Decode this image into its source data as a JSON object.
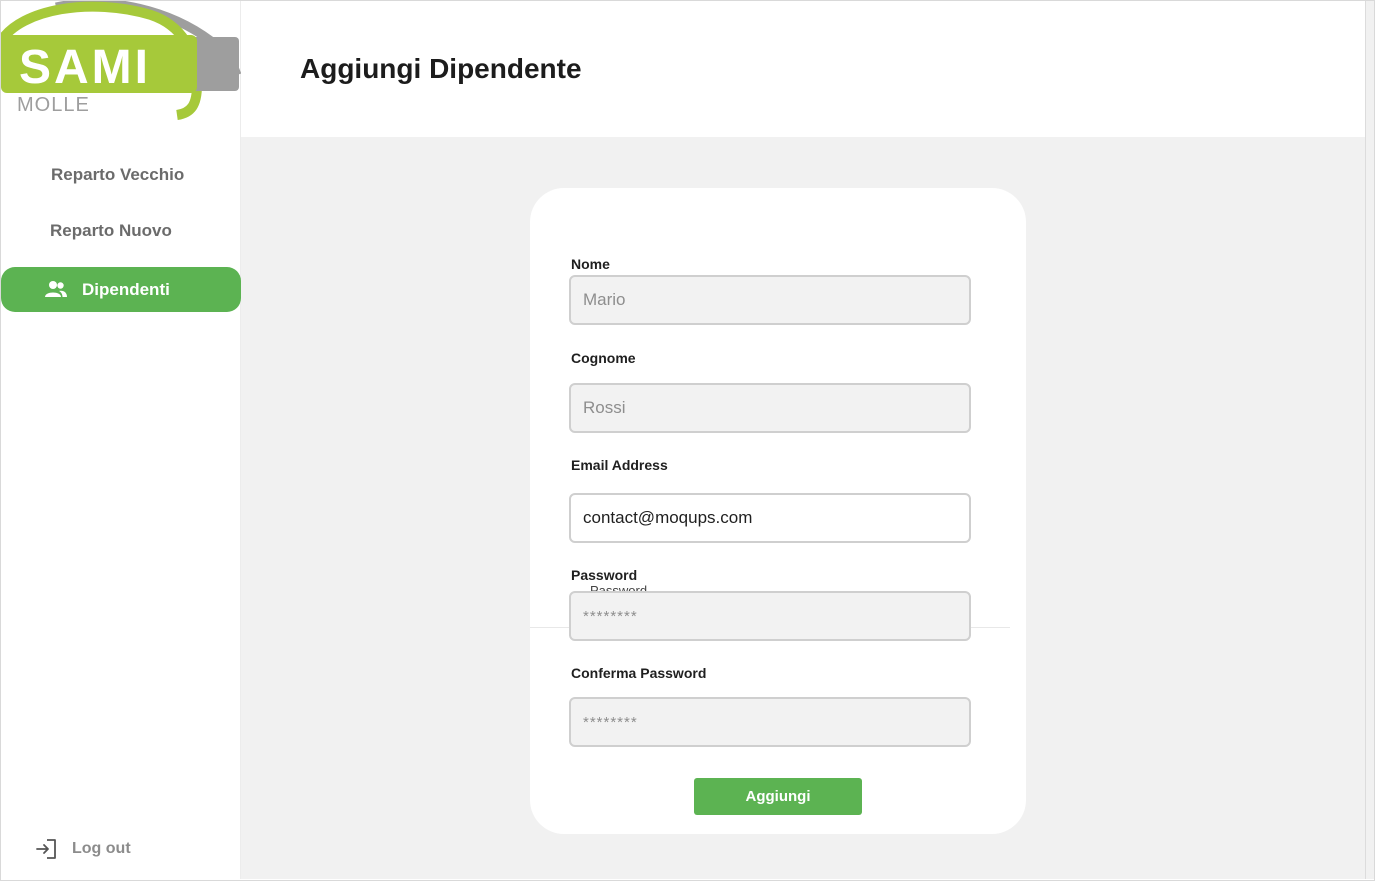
{
  "brand": {
    "name": "SAMI",
    "subtitle": "MOLLE",
    "green": "#A6C93A",
    "gray": "#9E9E9E"
  },
  "sidebar": {
    "items": [
      {
        "label": "Reparto Vecchio",
        "icon": null
      },
      {
        "label": "Reparto Nuovo",
        "icon": null
      },
      {
        "label": "Dipendenti",
        "icon": "people-icon",
        "active": true
      }
    ],
    "logout": {
      "label": "Log out",
      "icon": "logout-icon"
    }
  },
  "header": {
    "title": "Aggiungi Dipendente"
  },
  "form": {
    "nome": {
      "label": "Nome",
      "placeholder": "Mario"
    },
    "cognome": {
      "label": "Cognome",
      "placeholder": "Rossi"
    },
    "email": {
      "label": "Email Address",
      "value": "contact@moqups.com"
    },
    "password": {
      "label": "Password",
      "placeholder": "********",
      "ghost": "Password"
    },
    "conferma": {
      "label": "Conferma Password",
      "placeholder": "********"
    },
    "submit_label": "Aggiungi"
  },
  "colors": {
    "accent": "#5CB352",
    "background": "#F1F1F1",
    "card": "#FFFFFF"
  }
}
